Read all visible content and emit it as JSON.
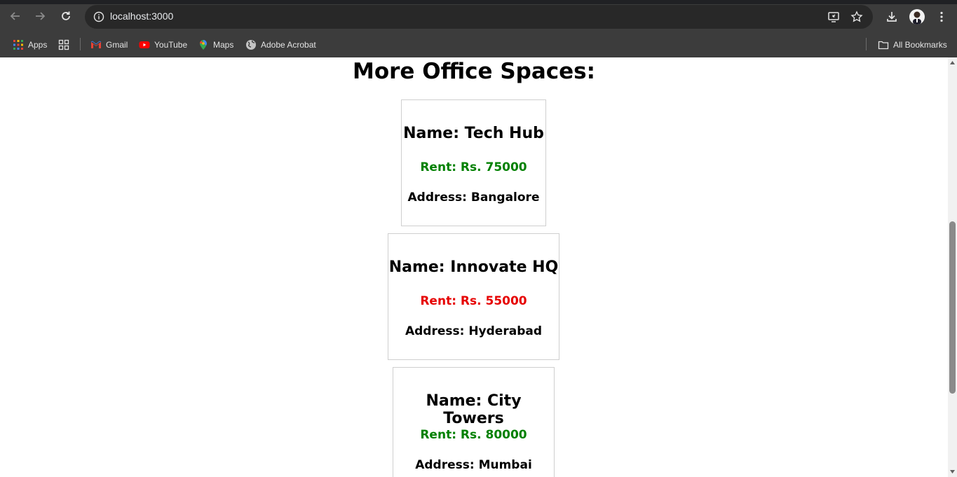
{
  "browser": {
    "url": "localhost:3000",
    "bookmarks": {
      "apps": "Apps",
      "gmail": "Gmail",
      "youtube": "YouTube",
      "maps": "Maps",
      "acrobat": "Adobe Acrobat",
      "all": "All Bookmarks"
    }
  },
  "page": {
    "title": "More Office Spaces:",
    "offices": [
      {
        "name": "Name: Tech Hub",
        "rent": "Rent: Rs. 75000",
        "address": "Address: Bangalore",
        "rent_color": "#008000"
      },
      {
        "name": "Name: Innovate HQ",
        "rent": "Rent: Rs. 55000",
        "address": "Address: Hyderabad",
        "rent_color": "#e60000"
      },
      {
        "name": "Name: City Towers",
        "rent": "Rent: Rs. 80000",
        "address": "Address: Mumbai",
        "rent_color": "#008000"
      }
    ]
  },
  "colors": {
    "chrome_bg": "#3c3c3c",
    "omnibox_bg": "#282828",
    "rent_high": "#008000",
    "rent_low": "#e60000"
  },
  "icons": [
    "back-arrow-icon",
    "forward-arrow-icon",
    "reload-icon",
    "site-info-icon",
    "install-app-icon",
    "star-icon",
    "download-icon",
    "menu-dots-icon",
    "apps-grid-icon",
    "tab-groups-icon",
    "gmail-icon",
    "youtube-icon",
    "maps-icon",
    "globe-icon",
    "folder-icon"
  ]
}
